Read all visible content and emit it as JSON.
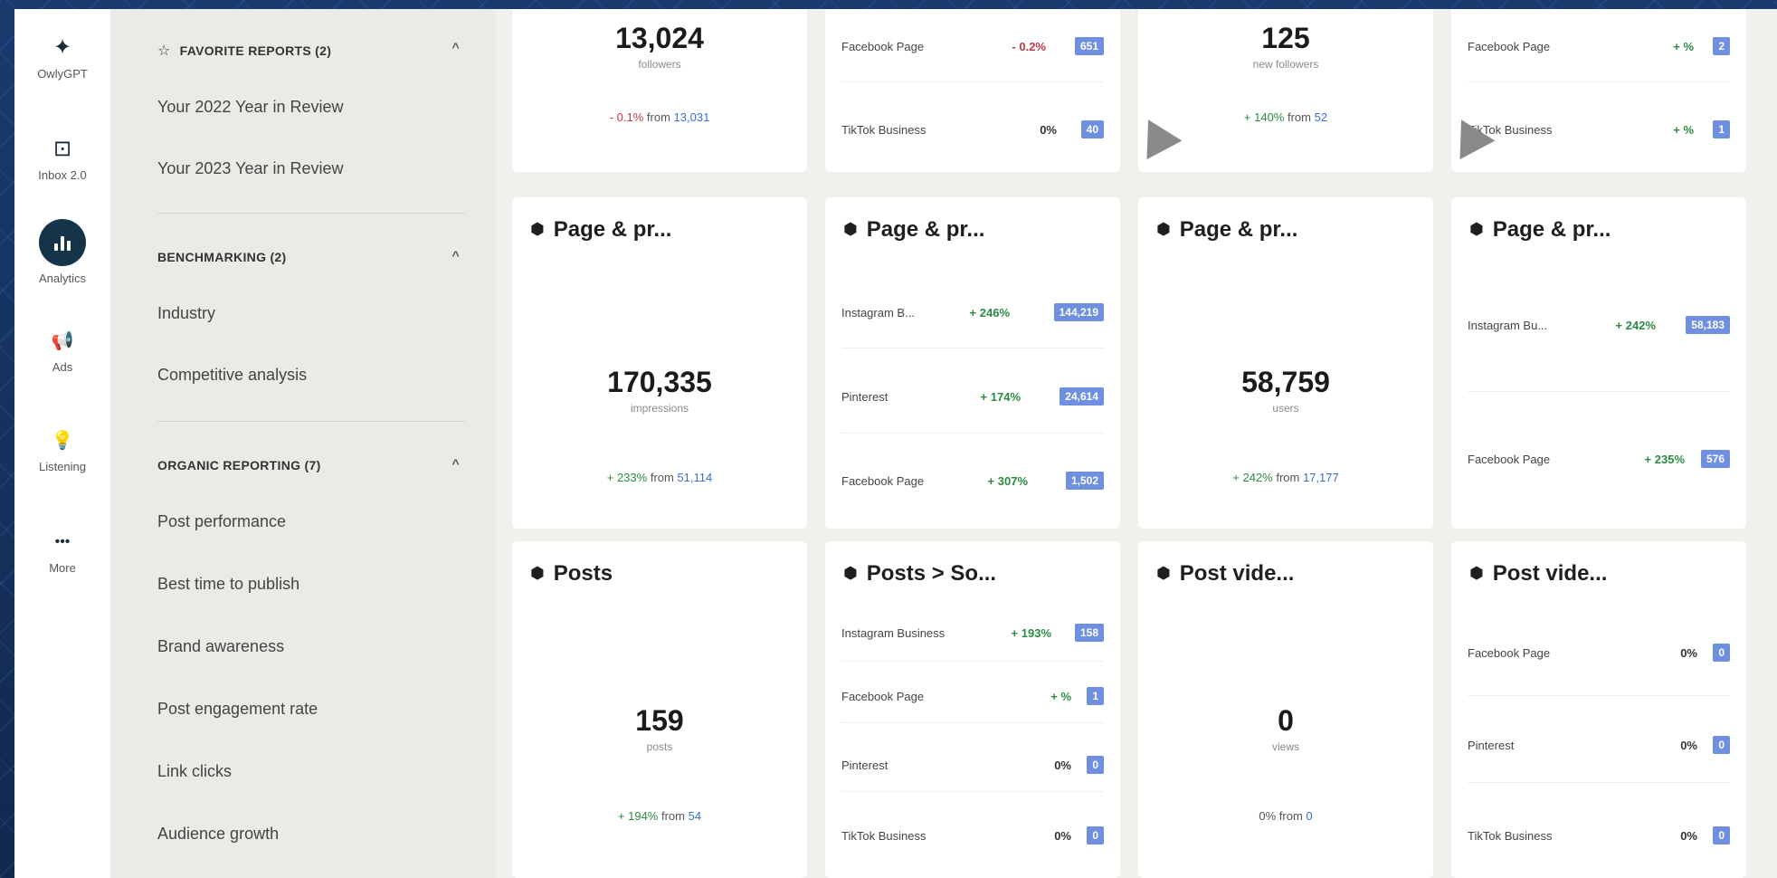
{
  "rail": {
    "items": [
      {
        "label": "OwlyGPT",
        "icon": "sparkle-icon"
      },
      {
        "label": "Inbox 2.0",
        "icon": "inbox-icon"
      },
      {
        "label": "Analytics",
        "icon": "analytics-icon"
      },
      {
        "label": "Ads",
        "icon": "megaphone-icon"
      },
      {
        "label": "Listening",
        "icon": "lightbulb-icon"
      },
      {
        "label": "More",
        "icon": "more-icon"
      }
    ]
  },
  "panel": {
    "favorites_header": "FAVORITE REPORTS (2)",
    "favorites": [
      "Your 2022 Year in Review",
      "Your 2023 Year in Review"
    ],
    "benchmarking_header": "BENCHMARKING (2)",
    "benchmarking": [
      "Industry",
      "Competitive analysis"
    ],
    "organic_header": "ORGANIC REPORTING (7)",
    "organic": [
      "Post performance",
      "Best time to publish",
      "Brand awareness",
      "Post engagement rate",
      "Link clicks",
      "Audience growth"
    ]
  },
  "cards": {
    "followers": {
      "value": "13,024",
      "unit": "followers",
      "change": "- 0.1%",
      "from_label": "from",
      "from_value": "13,031"
    },
    "followers_breakdown": [
      {
        "label": "Facebook Page",
        "change": "- 0.2%",
        "badge": "651"
      },
      {
        "label": "TikTok Business",
        "change": "0%",
        "badge": "40"
      }
    ],
    "new_followers": {
      "value": "125",
      "unit": "new followers",
      "change": "+ 140%",
      "from_label": "from",
      "from_value": "52"
    },
    "new_followers_breakdown": [
      {
        "label": "Facebook Page",
        "change": "+ %",
        "badge": "2"
      },
      {
        "label": "TikTok Business",
        "change": "+ %",
        "badge": "1"
      }
    ],
    "impressions": {
      "title": "Page & pr...",
      "value": "170,335",
      "unit": "impressions",
      "change": "+ 233%",
      "from_label": "from",
      "from_value": "51,114"
    },
    "impressions_breakdown": {
      "title": "Page & pr...",
      "rows": [
        {
          "label": "Instagram B...",
          "change": "+ 246%",
          "badge": "144,219"
        },
        {
          "label": "Pinterest",
          "change": "+ 174%",
          "badge": "24,614"
        },
        {
          "label": "Facebook Page",
          "change": "+ 307%",
          "badge": "1,502"
        }
      ]
    },
    "users": {
      "title": "Page & pr...",
      "value": "58,759",
      "unit": "users",
      "change": "+ 242%",
      "from_label": "from",
      "from_value": "17,177"
    },
    "users_breakdown": {
      "title": "Page & pr...",
      "rows": [
        {
          "label": "Instagram Bu...",
          "change": "+ 242%",
          "badge": "58,183"
        },
        {
          "label": "Facebook Page",
          "change": "+ 235%",
          "badge": "576"
        }
      ]
    },
    "posts": {
      "title": "Posts",
      "value": "159",
      "unit": "posts",
      "change": "+ 194%",
      "from_label": "from",
      "from_value": "54"
    },
    "posts_breakdown": {
      "title": "Posts > So...",
      "rows": [
        {
          "label": "Instagram Business",
          "change": "+ 193%",
          "badge": "158"
        },
        {
          "label": "Facebook Page",
          "change": "+ %",
          "badge": "1"
        },
        {
          "label": "Pinterest",
          "change": "0%",
          "badge": "0"
        },
        {
          "label": "TikTok Business",
          "change": "0%",
          "badge": "0"
        }
      ]
    },
    "views": {
      "title": "Post vide...",
      "value": "0",
      "unit": "views",
      "change": "0%",
      "from_label": "from",
      "from_value": "0"
    },
    "views_breakdown": {
      "title": "Post vide...",
      "rows": [
        {
          "label": "Facebook Page",
          "change": "0%",
          "badge": "0"
        },
        {
          "label": "Pinterest",
          "change": "0%",
          "badge": "0"
        },
        {
          "label": "TikTok Business",
          "change": "0%",
          "badge": "0"
        }
      ]
    }
  }
}
